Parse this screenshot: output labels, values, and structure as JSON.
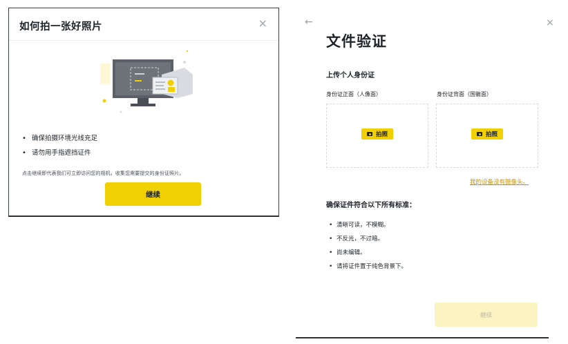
{
  "left_modal": {
    "title": "如何拍一张好照片",
    "close_icon": "×",
    "tips": [
      "确保拍摄环境光线充足",
      "请勿用手指遮挡证件"
    ],
    "consent_text": "点击继续即代表我们可立即访问您的相机，收集您需要提交的身份证照片。",
    "continue_label": "继续",
    "accent_color": "#f0d000"
  },
  "right_panel": {
    "back_icon": "←",
    "close_icon": "×",
    "title": "文件验证",
    "upload_heading": "上传个人身份证",
    "front_label": "身份证正面（人像面）",
    "back_label": "身份证背面（国徽面）",
    "take_photo_label": "拍照",
    "no_camera_link": "我的设备没有摄像头。",
    "standards_title": "确保证件符合以下所有标准：",
    "standards": [
      "清晰可读，不模糊。",
      "不反光，不过暗。",
      "尚未编辑。",
      "请将证件置于纯色背景下。"
    ],
    "continue_label": "继续",
    "continue_disabled_color": "#fbf3c2"
  },
  "icons": {
    "camera": "camera-icon",
    "back": "arrow-left-icon",
    "close": "close-icon"
  }
}
